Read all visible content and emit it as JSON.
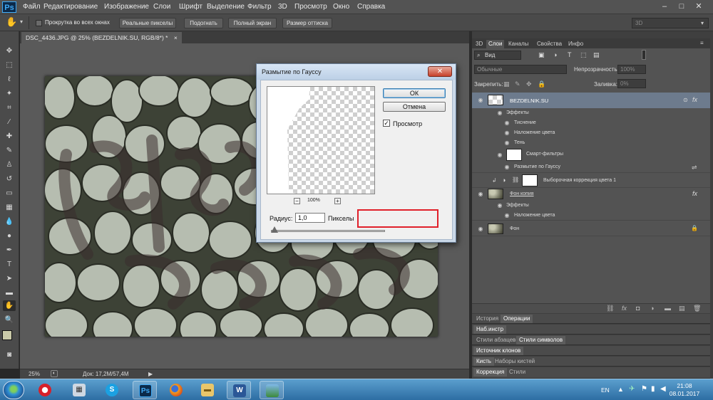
{
  "app": {
    "logo": "Ps"
  },
  "menu": [
    "Файл",
    "Редактирование",
    "Изображение",
    "Слои",
    "Шрифт",
    "Выделение",
    "Фильтр",
    "3D",
    "Просмотр",
    "Окно",
    "Справка"
  ],
  "window_controls": {
    "minimize": "–",
    "maximize": "□",
    "close": "✕"
  },
  "options": {
    "scroll_all": "Прокрутка во всех окнах",
    "real_pixels": "Реальные пикселы",
    "fit": "Подогнать",
    "full_screen": "Полный экран",
    "print_size": "Размер оттиска",
    "workspace": "3D"
  },
  "document": {
    "tab": "DSC_4436.JPG @ 25% (BEZDELNIK.SU, RGB/8*) *",
    "close": "×"
  },
  "status": {
    "zoom": "25%",
    "doc": "Док: 17,2M/57,4M"
  },
  "dialog": {
    "title": "Размытие по Гауссу",
    "close": "✕",
    "ok": "ОК",
    "cancel": "Отмена",
    "preview_label": "Просмотр",
    "preview_checked": true,
    "zoom": "100%",
    "zoom_minus": "−",
    "zoom_plus": "+",
    "radius_label": "Радиус:",
    "radius_value": "1,0",
    "radius_unit": "Пикселы"
  },
  "panel_tabs": [
    "3D",
    "Слои",
    "Каналы",
    "Свойства",
    "Инфо"
  ],
  "layers": {
    "kind_filter": "Вид",
    "blend_mode": "Обычные",
    "opacity_label": "Непрозрачность:",
    "opacity_value": "100%",
    "lock_label": "Закрепить:",
    "fill_label": "Заливка:",
    "fill_value": "0%",
    "fx": "fx",
    "rows": [
      {
        "name": "BEZDELNIK.SU"
      },
      {
        "name": "Эффекты"
      },
      {
        "name": "Тиснение"
      },
      {
        "name": "Наложение цвета"
      },
      {
        "name": "Тень"
      },
      {
        "name": "Смарт-фильтры"
      },
      {
        "name": "Размытие по Гауссу"
      },
      {
        "name": "Выборочная коррекция цвета 1"
      },
      {
        "name": "Фон копия"
      },
      {
        "name": "Эффекты"
      },
      {
        "name": "Наложение цвета"
      },
      {
        "name": "Фон"
      }
    ]
  },
  "bottom_panels": [
    {
      "tabs": [
        "История",
        "Операции"
      ]
    },
    {
      "tabs": [
        "Наб.инстр"
      ]
    },
    {
      "tabs": [
        "Стили абзацев",
        "Стили символов"
      ]
    },
    {
      "tabs": [
        "Источник клонов"
      ]
    },
    {
      "tabs": [
        "Кисть",
        "Наборы кистей"
      ]
    },
    {
      "tabs": [
        "Коррекция",
        "Стили"
      ]
    }
  ],
  "taskbar": {
    "lang": "EN",
    "time": "21:08",
    "date": "08.01.2017",
    "ps_label": "Ps",
    "word_label": "W"
  },
  "colors": {
    "ps_blue": "#3fa9f5",
    "highlight_red": "#e0202a",
    "selected_layer": "#6d7b8d"
  }
}
